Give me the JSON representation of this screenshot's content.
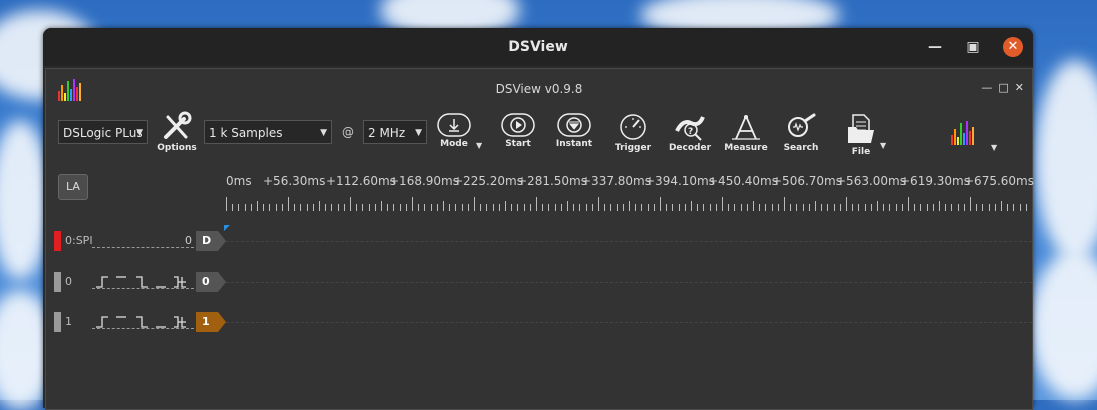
{
  "window": {
    "title": "DSView"
  },
  "app": {
    "title": "DSView v0.9.8"
  },
  "toolbar": {
    "device": "DSLogic PLus",
    "options_label": "Options",
    "samples": "1 k Samples",
    "at_symbol": "@",
    "rate": "2 MHz",
    "mode_label": "Mode",
    "start_label": "Start",
    "instant_label": "Instant",
    "trigger_label": "Trigger",
    "decoder_label": "Decoder",
    "measure_label": "Measure",
    "search_label": "Search",
    "file_label": "File"
  },
  "la_button": "LA",
  "ruler": {
    "labels": [
      "0ms",
      "+56.30ms",
      "+112.60ms",
      "+168.90ms",
      "+225.20ms",
      "+281.50ms",
      "+337.80ms",
      "+394.10ms",
      "+450.40ms",
      "+506.70ms",
      "+563.00ms",
      "+619.30ms",
      "+675.60ms"
    ]
  },
  "channels": [
    {
      "name": "0:SPI",
      "value": "0",
      "tag": "D",
      "marker_color": "#e02020",
      "tag_color": "#555555"
    },
    {
      "name": "0",
      "value": "",
      "tag": "0",
      "marker_color": "#9a9a9a",
      "tag_color": "#555555"
    },
    {
      "name": "1",
      "value": "",
      "tag": "1",
      "marker_color": "#9a9a9a",
      "tag_color": "#a06010"
    }
  ],
  "colors": {
    "close": "#e25c2a",
    "background": "#333333"
  }
}
